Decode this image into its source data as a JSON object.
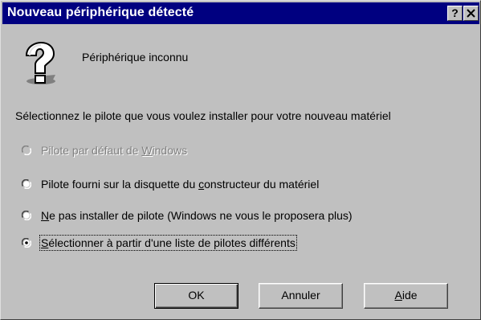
{
  "window": {
    "title": "Nouveau périphérique détecté",
    "help_glyph": "?",
    "colors": {
      "title_bar": "#000080",
      "face": "#c0c0c0",
      "disabled_text": "#808080"
    }
  },
  "device": {
    "icon": "unknown-device-question-icon",
    "name": "Périphérique inconnu"
  },
  "instruction": "Sélectionnez le pilote que vous voulez installer pour votre nouveau matériel",
  "options": [
    {
      "pre": "Pilote par défaut de ",
      "key": "W",
      "post": "indows",
      "selected": false,
      "disabled": true
    },
    {
      "pre": "Pilote fourni sur la disquette du ",
      "key": "c",
      "post": "onstructeur du matériel",
      "selected": false,
      "disabled": false
    },
    {
      "pre": "",
      "key": "N",
      "post": "e pas installer de pilote (Windows ne vous le proposera plus)",
      "selected": false,
      "disabled": false
    },
    {
      "pre": "",
      "key": "S",
      "post": "électionner à partir d'une liste de pilotes différents",
      "selected": true,
      "disabled": false
    }
  ],
  "buttons": {
    "ok": "OK",
    "cancel": "Annuler",
    "help_pre": "",
    "help_key": "A",
    "help_post": "ide"
  }
}
